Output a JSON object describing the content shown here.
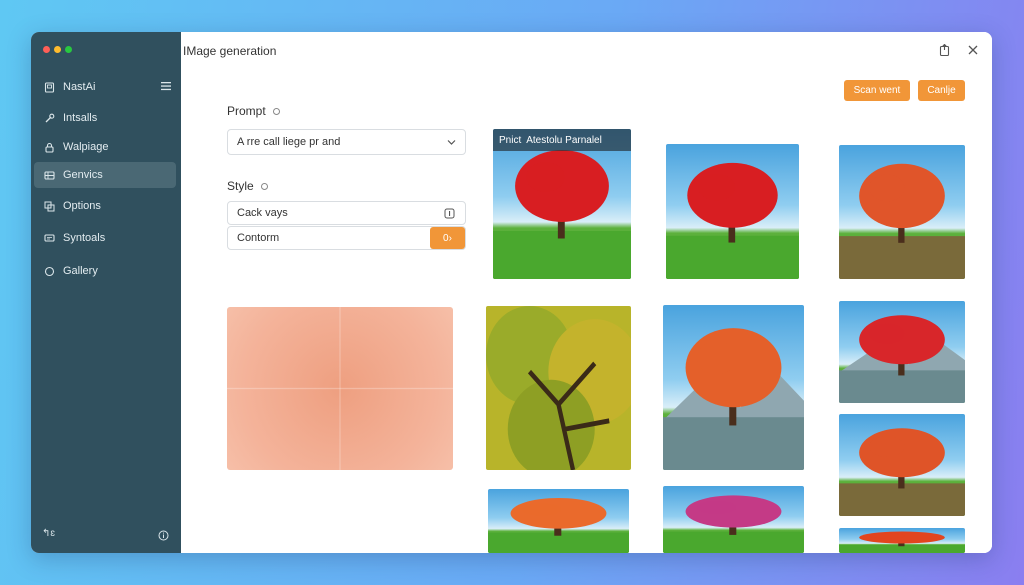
{
  "sidebar": {
    "items": [
      {
        "label": "NastAi",
        "icon": "device-icon"
      },
      {
        "label": "Intsalls",
        "icon": "wrench-icon"
      },
      {
        "label": "Walpiage",
        "icon": "lock-icon"
      },
      {
        "label": "Genvics",
        "icon": "grid-icon",
        "active": true
      },
      {
        "label": "Options",
        "icon": "layers-icon"
      },
      {
        "label": "Syntoals",
        "icon": "chat-icon"
      },
      {
        "label": "Gallery",
        "icon": "circle-icon"
      }
    ],
    "footer_left": "↰ɛ",
    "traffic_colors": [
      "#ff5f57",
      "#febc2e",
      "#28c840"
    ]
  },
  "header": {
    "title": "IMage generation",
    "btn_primary": "Scan went",
    "btn_secondary": "Canlje"
  },
  "form": {
    "prompt_label": "Prompt",
    "prompt_value": "A rre call liege pr and",
    "style_label": "Style",
    "style_field_1": "Cack vays",
    "style_field_2": "Contorm",
    "style_btn": "0›"
  },
  "gallery": {
    "caption_prefix": "Pnict",
    "caption_title": "Atestolu Parnalel",
    "thumbs": [
      {
        "tree": "#d81e22",
        "scene": "meadow"
      },
      {
        "tree": "#d81e22",
        "scene": "meadow"
      },
      {
        "tree": "#e0552a",
        "scene": "dry"
      },
      {
        "tree": "#8aa424",
        "scene": "canopy"
      },
      {
        "tree": "#e4602a",
        "scene": "mountain"
      },
      {
        "tree": "#d8262a",
        "scene": "mountain"
      },
      {
        "tree": "#df5428",
        "scene": "dry"
      },
      {
        "tree": "#ea6a2c",
        "scene": "meadow"
      },
      {
        "tree": "#c43a86",
        "scene": "meadow"
      },
      {
        "tree": "#e2451f",
        "scene": "meadow"
      }
    ]
  },
  "colors": {
    "accent": "#f19638",
    "sidebar_bg": "#30505e"
  }
}
